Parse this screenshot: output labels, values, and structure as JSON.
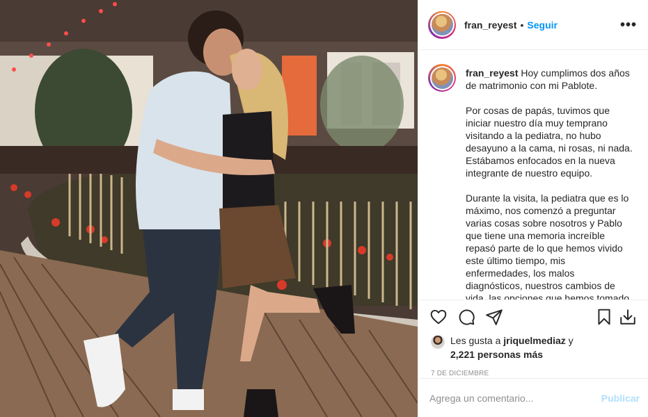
{
  "post": {
    "username": "fran_reyest",
    "follow_label": "Seguir",
    "separator": "•",
    "more_label": "•••"
  },
  "caption": {
    "username": "fran_reyest",
    "paragraphs": [
      "Hoy cumplimos dos años de matrimonio con mi Pablote.",
      "Por cosas de papás, tuvimos que iniciar nuestro día muy temprano visitando a la pediatra, no hubo desayuno a la cama, ni rosas, ni nada. Estábamos enfocados en la nueva integrante de nuestro equipo.",
      "Durante la visita, la pediatra que es lo máximo, nos comenzó a preguntar varias cosas sobre nosotros y Pablo que tiene una memoria increíble repasó parte de lo que hemos vivido este último tiempo, mis enfermedades, los malos diagnósticos, nuestros cambios de vida, las opciones que hemos tomado, el embarazo, la"
    ]
  },
  "actions": {
    "like_icon": "heart-icon",
    "comment_icon": "comment-icon",
    "share_icon": "paper-plane-icon",
    "save_icon": "bookmark-icon",
    "download_icon": "download-icon"
  },
  "likes": {
    "prefix": "Les gusta a",
    "user": "jriquelmediaz",
    "connector": "y",
    "others": "2,221 personas más"
  },
  "date": "7 de diciembre",
  "comment": {
    "placeholder": "Agrega un comentario...",
    "publish_label": "Publicar"
  },
  "colors": {
    "link_blue": "#0095f6",
    "publish_disabled": "#b2dffc",
    "text": "#262626",
    "muted": "#8e8e8e"
  }
}
